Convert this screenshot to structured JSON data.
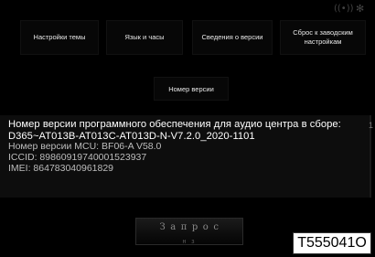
{
  "status": {
    "wifi_icon": "((•))",
    "bluetooth_icon": "✻"
  },
  "tabs": [
    {
      "label": "Настройки темы"
    },
    {
      "label": "Язык и часы"
    },
    {
      "label": "Сведения о версии"
    },
    {
      "label": "Сброс к заводским настройкам"
    }
  ],
  "version_button": {
    "label": "Номер версии"
  },
  "info": {
    "firmware_line_1": "Номер версии программного обеспечения для аудио центра в сборе:",
    "firmware_line_2": "D365~AT013B-AT013C-AT013D-N-V7.2.0_2020-1101",
    "mcu_line": "Номер версии MCU: BF06-A V58.0",
    "iccid_line": "ICCID: 89860919740001523937",
    "imei_line": "IMEI: 864783040961829",
    "scroll_mark": "1"
  },
  "query_button": {
    "label": "Запрос",
    "sublabel": "н з"
  },
  "stamp": {
    "text": "T555041O"
  }
}
